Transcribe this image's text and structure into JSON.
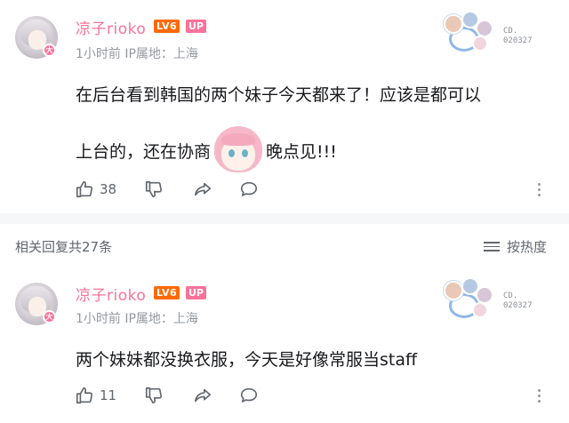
{
  "main_comment": {
    "username": "凉子rioko",
    "level": "LV6",
    "up_badge": "UP",
    "avatar_badge": "大",
    "meta": "1小时前 IP属地：上海",
    "deco_code_1": "CD.",
    "deco_code_2": "020327",
    "text_line1": "在后台看到韩国的两个妹子今天都来了！应该是都可以",
    "text_line2_a": "上台的，还在协商",
    "text_line2_b": "晚点见!!!",
    "like_count": "38"
  },
  "replies_header": {
    "title": "相关回复共27条",
    "sort_label": "按热度"
  },
  "reply_comment": {
    "username": "凉子rioko",
    "level": "LV6",
    "up_badge": "UP",
    "avatar_badge": "大",
    "meta": "1小时前 IP属地：上海",
    "deco_code_1": "CD.",
    "deco_code_2": "020327",
    "text": "两个妹妹都没换衣服，今天是好像常服当staff",
    "like_count": "11"
  },
  "icons": [
    "thumbs-up-icon",
    "thumbs-down-icon",
    "share-icon",
    "comment-icon",
    "more-icon",
    "sort-icon"
  ],
  "colors": {
    "accent": "#fb7299",
    "level": "#ff6a00",
    "meta": "#9499a0"
  }
}
